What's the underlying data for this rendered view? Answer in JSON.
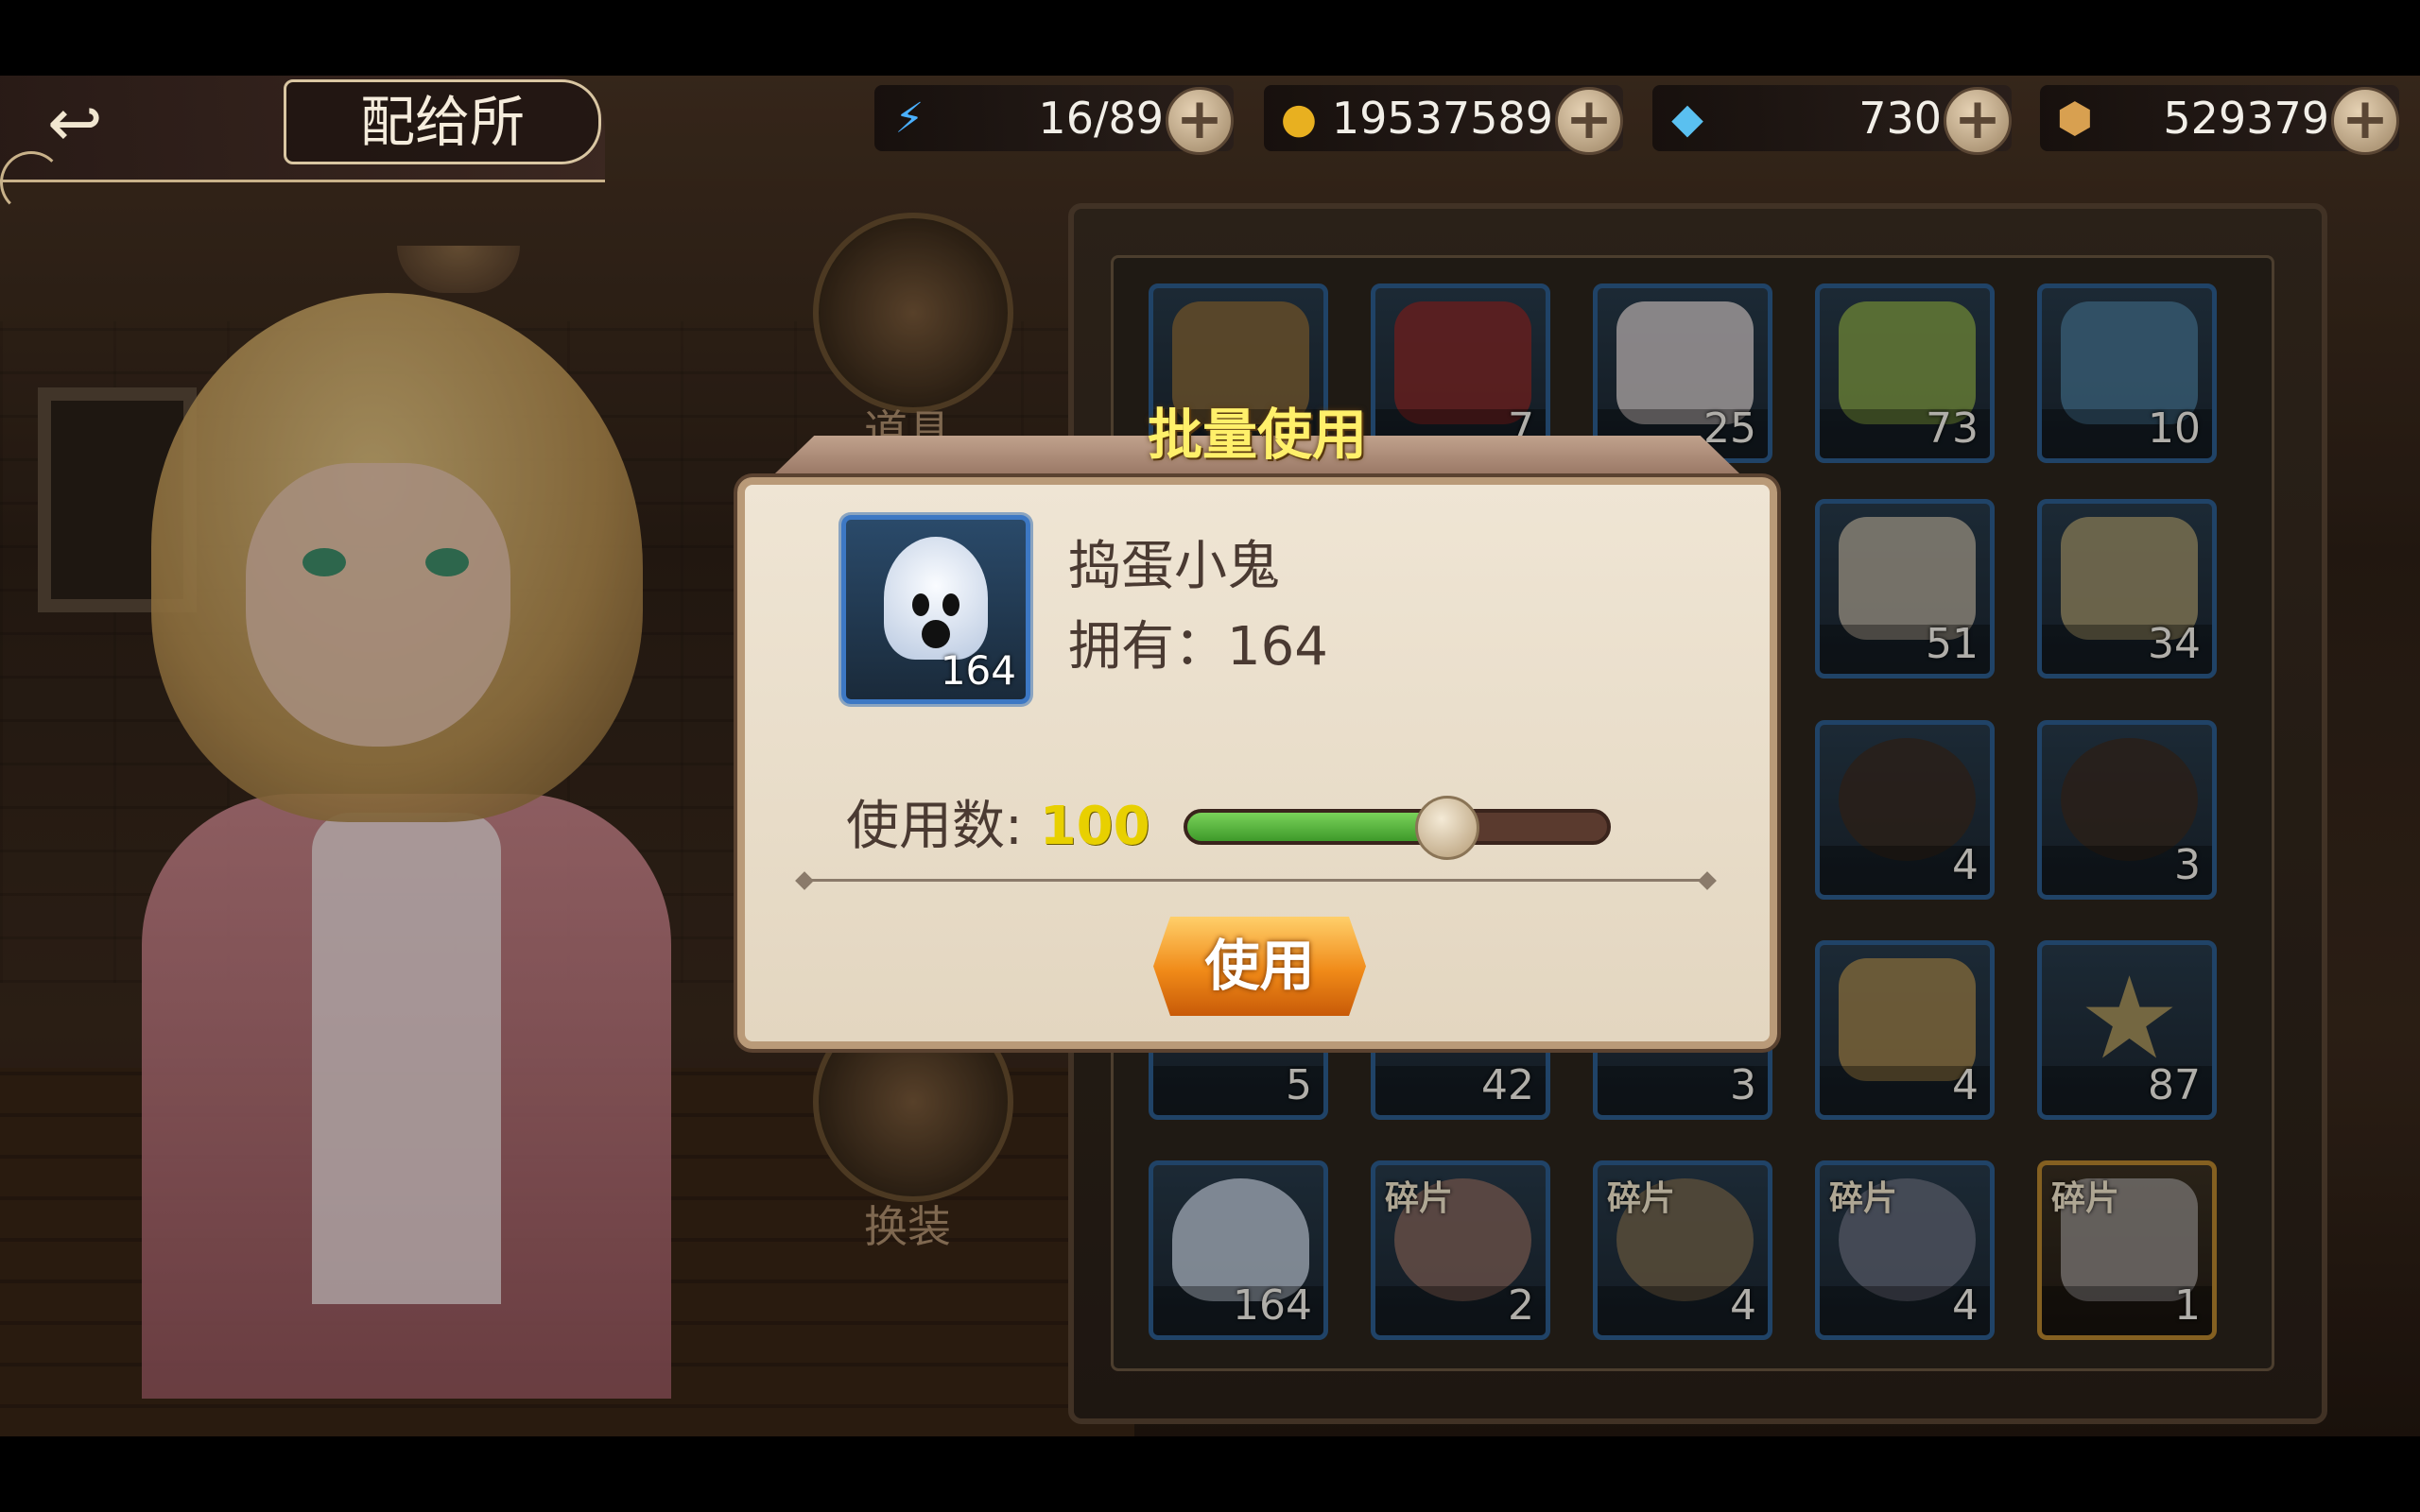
{
  "header": {
    "back_label": "",
    "title": "配给所"
  },
  "resources": [
    {
      "icon": "lightning-icon",
      "value": "16/89"
    },
    {
      "icon": "gold-coin-icon",
      "value": "19537589"
    },
    {
      "icon": "crystal-icon",
      "value": "730"
    },
    {
      "icon": "hexagon-token-icon",
      "value": "529379"
    }
  ],
  "categories": [
    {
      "label": "道具"
    },
    {
      "label": "换装"
    }
  ],
  "inventory": {
    "rows": [
      [
        {
          "count": ""
        },
        {
          "count": "7"
        },
        {
          "count": "25"
        },
        {
          "count": "73"
        },
        {
          "count": "10"
        }
      ],
      [
        {
          "count": "51"
        },
        {
          "count": "34"
        }
      ],
      [
        {
          "count": "4"
        },
        {
          "count": "3"
        }
      ],
      [
        {
          "count": "5"
        },
        {
          "count": "42"
        },
        {
          "count": "3"
        },
        {
          "count": "4"
        },
        {
          "count": "87"
        }
      ],
      [
        {
          "count": "164"
        },
        {
          "count": "2",
          "tag": "碎片"
        },
        {
          "count": "4",
          "tag": "碎片"
        },
        {
          "count": "4",
          "tag": "碎片"
        },
        {
          "count": "1",
          "tag": "碎片"
        }
      ]
    ]
  },
  "dialog": {
    "title": "批量使用",
    "item_name": "捣蛋小鬼",
    "item_count": "164",
    "owned_text": "拥有：164",
    "use_label": "使用数:",
    "use_value": "100",
    "slider_fraction": 0.61,
    "use_button": "使用"
  },
  "colors": {
    "accent_yellow": "#fff06a",
    "slider_green": "#5ab83a",
    "button_orange": "#f08a18",
    "slot_border_blue": "#2d5d8f",
    "slot_border_gold": "#b8862e"
  }
}
